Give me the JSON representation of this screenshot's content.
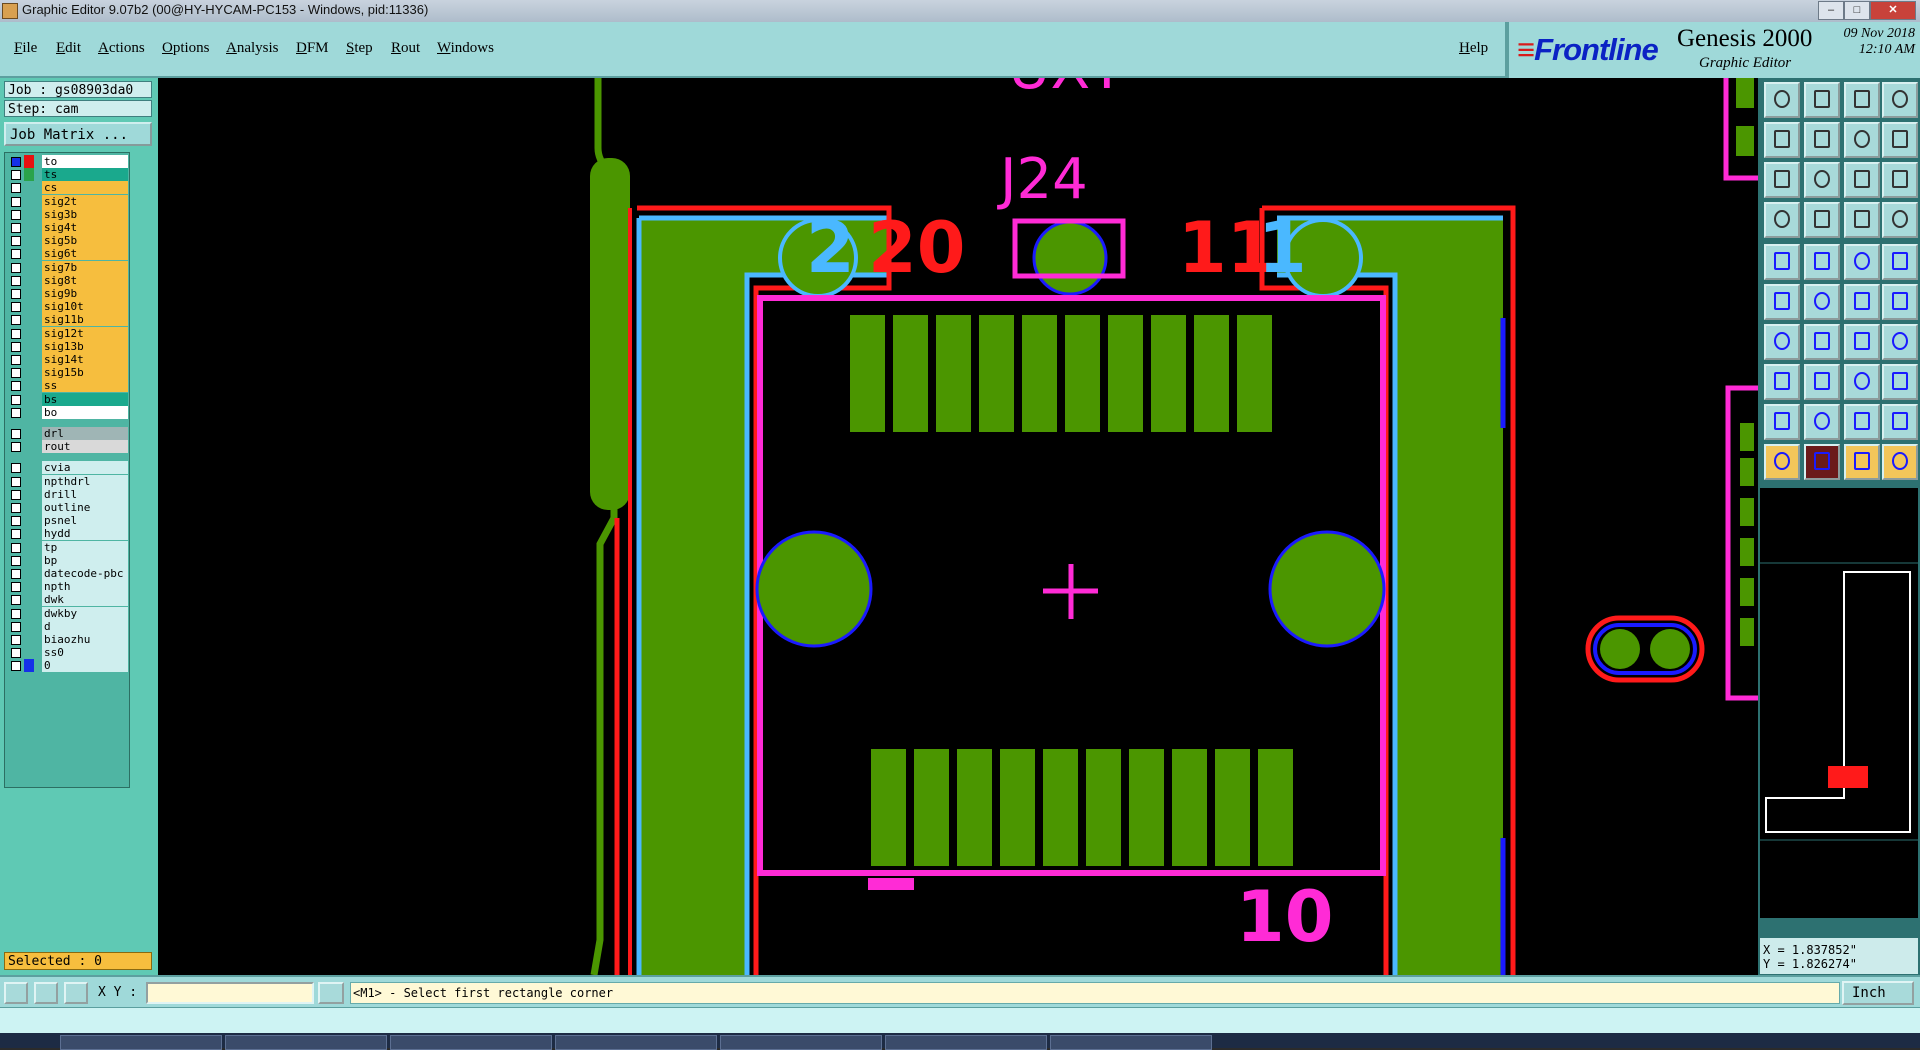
{
  "window": {
    "title": "Graphic Editor 9.07b2 (00@HY-HYCAM-PC153 - Windows, pid:11336)",
    "min": "–",
    "max": "□",
    "close": "✕"
  },
  "menu": [
    "File",
    "Edit",
    "Actions",
    "Options",
    "Analysis",
    "DFM",
    "Step",
    "Rout",
    "Windows"
  ],
  "help": "Help",
  "brand": {
    "logo": "Frontline",
    "product": "Genesis 2000",
    "subtitle": "Graphic Editor",
    "date": "09 Nov 2018",
    "time": "12:10 AM"
  },
  "job": {
    "job": "Job : gs08903da0",
    "step": "Step: cam",
    "matrix_button": "Job Matrix ..."
  },
  "layers": [
    {
      "name": "to",
      "color": "#ffffff",
      "swatch": "#e81010",
      "checked": true
    },
    {
      "name": "ts",
      "color": "#1aa98d",
      "swatch": "#2aa34a",
      "checked": false
    },
    {
      "name": "cs",
      "color": "#f6be3e",
      "swatch": "",
      "checked": false
    },
    {
      "name": "sig2t",
      "color": "#f6be3e",
      "swatch": "",
      "checked": false
    },
    {
      "name": "sig3b",
      "color": "#f6be3e",
      "swatch": "",
      "checked": false
    },
    {
      "name": "sig4t",
      "color": "#f6be3e",
      "swatch": "",
      "checked": false
    },
    {
      "name": "sig5b",
      "color": "#f6be3e",
      "swatch": "",
      "checked": false
    },
    {
      "name": "sig6t",
      "color": "#f6be3e",
      "swatch": "",
      "checked": false
    },
    {
      "name": "sig7b",
      "color": "#f6be3e",
      "swatch": "",
      "checked": false
    },
    {
      "name": "sig8t",
      "color": "#f6be3e",
      "swatch": "",
      "checked": false
    },
    {
      "name": "sig9b",
      "color": "#f6be3e",
      "swatch": "",
      "checked": false
    },
    {
      "name": "sig10t",
      "color": "#f6be3e",
      "swatch": "",
      "checked": false
    },
    {
      "name": "sig11b",
      "color": "#f6be3e",
      "swatch": "",
      "checked": false
    },
    {
      "name": "sig12t",
      "color": "#f6be3e",
      "swatch": "",
      "checked": false
    },
    {
      "name": "sig13b",
      "color": "#f6be3e",
      "swatch": "",
      "checked": false
    },
    {
      "name": "sig14t",
      "color": "#f6be3e",
      "swatch": "",
      "checked": false
    },
    {
      "name": "sig15b",
      "color": "#f6be3e",
      "swatch": "",
      "checked": false
    },
    {
      "name": "ss",
      "color": "#f6be3e",
      "swatch": "",
      "checked": false
    },
    {
      "name": "bs",
      "color": "#1aa98d",
      "swatch": "",
      "checked": false
    },
    {
      "name": "bo",
      "color": "#ffffff",
      "swatch": "",
      "checked": false
    },
    {
      "name": "drl",
      "color": "#9fb5b5",
      "swatch": "",
      "checked": false
    },
    {
      "name": "rout",
      "color": "#d9d9d9",
      "swatch": "",
      "checked": false
    },
    {
      "name": "cvia",
      "color": "#cfeeee",
      "swatch": "",
      "checked": false
    },
    {
      "name": "npthdrl",
      "color": "#cfeeee",
      "swatch": "",
      "checked": false
    },
    {
      "name": "drill",
      "color": "#cfeeee",
      "swatch": "",
      "checked": false
    },
    {
      "name": "outline",
      "color": "#cfeeee",
      "swatch": "",
      "checked": false
    },
    {
      "name": "psnel",
      "color": "#cfeeee",
      "swatch": "",
      "checked": false
    },
    {
      "name": "hydd",
      "color": "#cfeeee",
      "swatch": "",
      "checked": false
    },
    {
      "name": "tp",
      "color": "#cfeeee",
      "swatch": "",
      "checked": false
    },
    {
      "name": "bp",
      "color": "#cfeeee",
      "swatch": "",
      "checked": false
    },
    {
      "name": "datecode-pbc",
      "color": "#cfeeee",
      "swatch": "",
      "checked": false
    },
    {
      "name": "npth",
      "color": "#cfeeee",
      "swatch": "",
      "checked": false
    },
    {
      "name": "dwk",
      "color": "#cfeeee",
      "swatch": "",
      "checked": false
    },
    {
      "name": "dwkby",
      "color": "#cfeeee",
      "swatch": "",
      "checked": false
    },
    {
      "name": "d",
      "color": "#cfeeee",
      "swatch": "",
      "checked": false
    },
    {
      "name": "biaozhu",
      "color": "#cfeeee",
      "swatch": "",
      "checked": false
    },
    {
      "name": "ss0",
      "color": "#cfeeee",
      "swatch": "",
      "checked": false
    },
    {
      "name": "0",
      "color": "#cfeeee",
      "swatch": "#1530e8",
      "checked": false
    }
  ],
  "selected": "Selected : 0",
  "canvas": {
    "labels": {
      "ref": "J24",
      "pin20": "20",
      "pin2": "2",
      "pin11": "11",
      "pin1": "1",
      "pin10": "10",
      "top": "UXT"
    }
  },
  "tools": [
    "select-arrow-icon"
  ],
  "coords": {
    "x": "X = 1.837852\"",
    "y": "Y = 1.826274\""
  },
  "status": {
    "xy_label": "X Y :",
    "xy_value": "",
    "prompt": "<M1> - Select first rectangle corner",
    "unit": "Inch"
  },
  "colors": {
    "green": "#4b9600",
    "red": "#ff1a1a",
    "magenta": "#ff2bd6",
    "cyan": "#4ab8ff",
    "blue": "#1a1aff"
  }
}
